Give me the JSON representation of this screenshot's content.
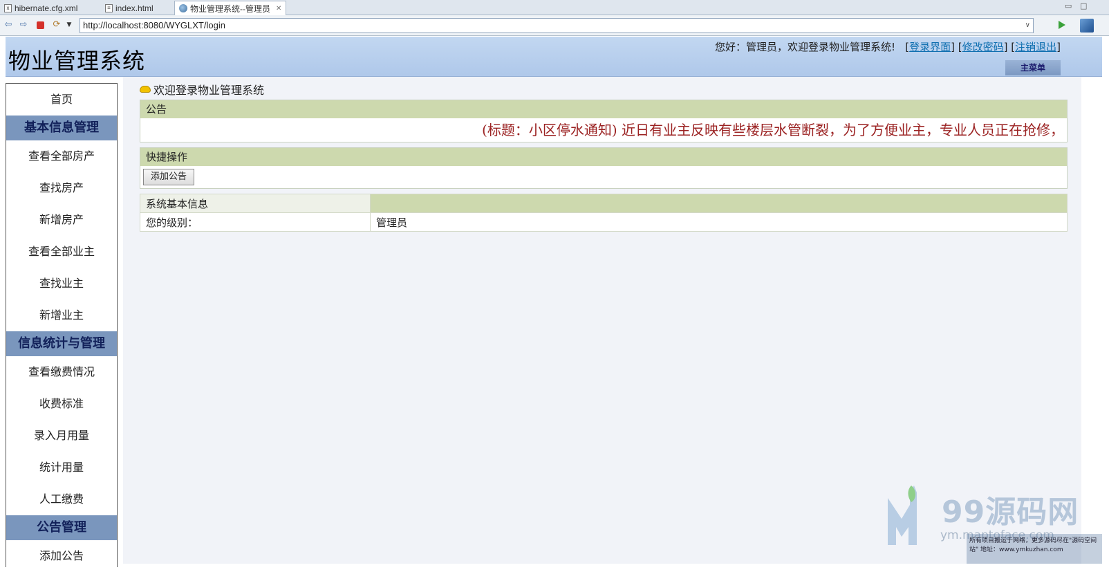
{
  "ide_tabs": [
    {
      "label": "hibernate.cfg.xml",
      "active": false
    },
    {
      "label": "index.html",
      "active": false
    },
    {
      "label": "物业管理系统--管理员",
      "active": true
    }
  ],
  "browser": {
    "url": "http://localhost:8080/WYGLXT/login"
  },
  "header": {
    "title": "物业管理系统",
    "greeting": "您好：管理员，欢迎登录物业管理系统!",
    "links": [
      "登录界面",
      "修改密码",
      "注销退出"
    ],
    "main_menu": "主菜单"
  },
  "sidebar": {
    "home": "首页",
    "sections": [
      {
        "title": "基本信息管理",
        "items": [
          "查看全部房产",
          "查找房产",
          "新增房产",
          "查看全部业主",
          "查找业主",
          "新增业主"
        ]
      },
      {
        "title": "信息统计与管理",
        "items": [
          "查看缴费情况",
          "收费标准",
          "录入月用量",
          "统计用量",
          "人工缴费"
        ]
      },
      {
        "title": "公告管理",
        "items": [
          "添加公告"
        ]
      }
    ]
  },
  "main": {
    "welcome": "欢迎登录物业管理系统",
    "notice": {
      "heading": "公告",
      "scroll_text": "(标题：小区停水通知) 近日有业主反映有些楼层水管断裂，为了方便业主，专业人员正在抢修，"
    },
    "quick": {
      "heading": "快捷操作",
      "button": "添加公告"
    },
    "sysinfo": {
      "heading": "系统基本信息",
      "rows": [
        {
          "label": "您的级别：",
          "value": "管理员"
        }
      ]
    }
  },
  "watermark": {
    "brand": "99源码网",
    "url": "ym.maptoface.com",
    "note": "所有项目搬运于网络，更多源码尽在\"源码空间站\"   地址：www.ymkuzhan.com"
  },
  "colors": {
    "header_bg": "#b9d0ef",
    "sidebar_head": "#7a96bd",
    "panel_head": "#cdd9ae",
    "notice_text": "#9b2222"
  }
}
